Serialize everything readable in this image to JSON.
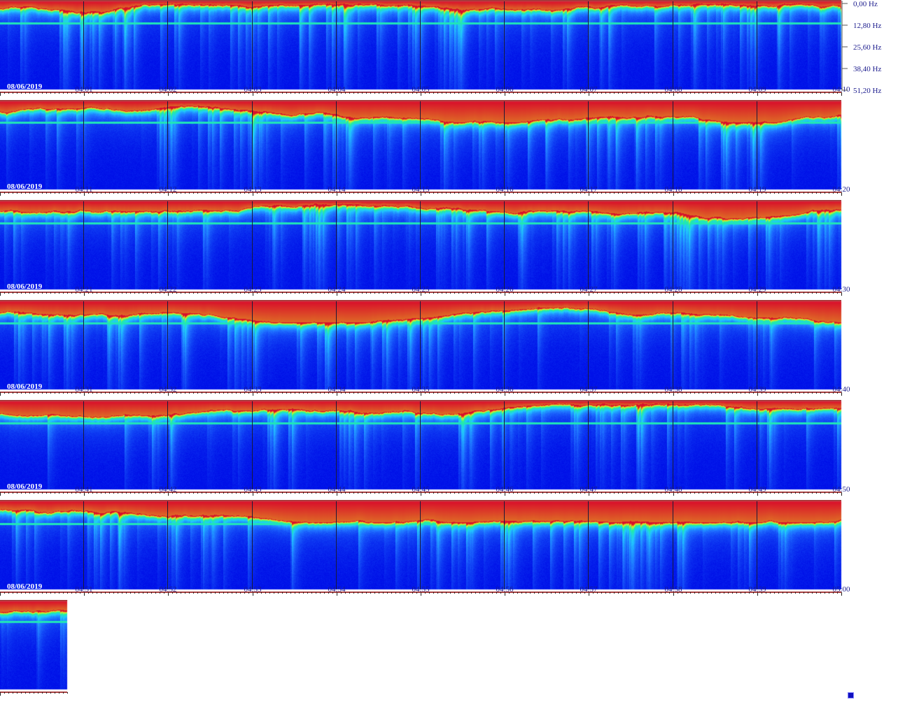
{
  "chart_data": {
    "type": "heatmap",
    "title": "",
    "xlabel": "",
    "ylabel": "",
    "date": "08/06/2019",
    "y_axis": {
      "unit": "Hz",
      "ticks": [
        "0,00 Hz",
        "12,80 Hz",
        "25,60 Hz",
        "38,40 Hz",
        "51,20 Hz"
      ],
      "range": [
        0,
        51.2
      ]
    },
    "colormap": [
      "#0010e8",
      "#1e6cff",
      "#22c8ff",
      "#20f0a0",
      "#e8f020",
      "#d8102a"
    ],
    "rows": [
      {
        "start": "04:00",
        "date": "08/06/2019",
        "ticks": [
          "04:01",
          "04:02",
          "04:03",
          "04:04",
          "04:05",
          "04:06",
          "04:07",
          "04:08",
          "04:09",
          "04:10"
        ]
      },
      {
        "start": "04:10",
        "date": "08/06/2019",
        "ticks": [
          "04:11",
          "04:12",
          "04:13",
          "04:14",
          "04:15",
          "04:16",
          "04:17",
          "04:18",
          "04:19",
          "04:20"
        ]
      },
      {
        "start": "04:20",
        "date": "08/06/2019",
        "ticks": [
          "04:21",
          "04:22",
          "04:23",
          "04:24",
          "04:25",
          "04:26",
          "04:27",
          "04:28",
          "04:29",
          "04:30"
        ]
      },
      {
        "start": "04:30",
        "date": "08/06/2019",
        "ticks": [
          "04:31",
          "04:32",
          "04:33",
          "04:34",
          "04:35",
          "04:36",
          "04:37",
          "04:38",
          "04:39",
          "04:40"
        ]
      },
      {
        "start": "04:40",
        "date": "08/06/2019",
        "ticks": [
          "04:41",
          "04:42",
          "04:43",
          "04:44",
          "04:45",
          "04:46",
          "04:47",
          "04:48",
          "04:49",
          "04:50"
        ]
      },
      {
        "start": "04:50",
        "date": "08/06/2019",
        "ticks": [
          "04:51",
          "04:52",
          "04:53",
          "04:54",
          "04:55",
          "04:56",
          "04:57",
          "04:58",
          "04:59",
          "05:00"
        ]
      },
      {
        "start": "05:00",
        "date": "",
        "ticks": [],
        "partial_minutes": 0.8
      }
    ]
  }
}
